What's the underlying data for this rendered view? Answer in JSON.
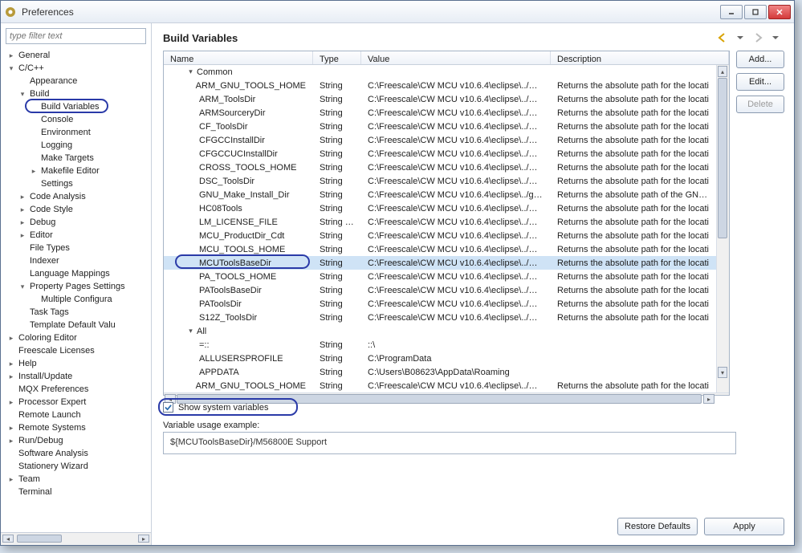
{
  "window": {
    "title": "Preferences"
  },
  "filter": {
    "placeholder": "type filter text"
  },
  "page": {
    "title": "Build Variables"
  },
  "tree": [
    {
      "label": "General",
      "expand": "closed"
    },
    {
      "label": "C/C++",
      "expand": "open",
      "children": [
        {
          "label": "Appearance"
        },
        {
          "label": "Build",
          "expand": "open",
          "children": [
            {
              "label": "Build Variables",
              "highlighted": true
            },
            {
              "label": "Console"
            },
            {
              "label": "Environment"
            },
            {
              "label": "Logging"
            },
            {
              "label": "Make Targets"
            },
            {
              "label": "Makefile Editor",
              "expand": "closed"
            },
            {
              "label": "Settings"
            }
          ]
        },
        {
          "label": "Code Analysis",
          "expand": "closed"
        },
        {
          "label": "Code Style",
          "expand": "closed"
        },
        {
          "label": "Debug",
          "expand": "closed"
        },
        {
          "label": "Editor",
          "expand": "closed"
        },
        {
          "label": "File Types"
        },
        {
          "label": "Indexer"
        },
        {
          "label": "Language Mappings"
        },
        {
          "label": "Property Pages Settings",
          "expand": "open",
          "children": [
            {
              "label": "Multiple Configura"
            }
          ]
        },
        {
          "label": "Task Tags"
        },
        {
          "label": "Template Default Valu"
        }
      ]
    },
    {
      "label": "Coloring Editor",
      "expand": "closed"
    },
    {
      "label": "Freescale Licenses"
    },
    {
      "label": "Help",
      "expand": "closed"
    },
    {
      "label": "Install/Update",
      "expand": "closed"
    },
    {
      "label": "MQX Preferences"
    },
    {
      "label": "Processor Expert",
      "expand": "closed"
    },
    {
      "label": "Remote Launch"
    },
    {
      "label": "Remote Systems",
      "expand": "closed"
    },
    {
      "label": "Run/Debug",
      "expand": "closed"
    },
    {
      "label": "Software Analysis"
    },
    {
      "label": "Stationery Wizard"
    },
    {
      "label": "Team",
      "expand": "closed"
    },
    {
      "label": "Terminal"
    }
  ],
  "columns": {
    "name": "Name",
    "type": "Type",
    "value": "Value",
    "desc": "Description"
  },
  "groups": {
    "common": "Common",
    "all": "All"
  },
  "rows_common": [
    {
      "name": "ARM_GNU_TOOLS_HOME",
      "type": "String",
      "value": "C:\\Freescale\\CW MCU v10.6.4\\eclipse\\../Cro...",
      "desc": "Returns the absolute path for the locati"
    },
    {
      "name": "ARM_ToolsDir",
      "type": "String",
      "value": "C:\\Freescale\\CW MCU v10.6.4\\eclipse\\../MC...",
      "desc": "Returns the absolute path for the locati"
    },
    {
      "name": "ARMSourceryDir",
      "type": "String",
      "value": "C:\\Freescale\\CW MCU v10.6.4\\eclipse\\../MC...",
      "desc": "Returns the absolute path for the locati"
    },
    {
      "name": "CF_ToolsDir",
      "type": "String",
      "value": "C:\\Freescale\\CW MCU v10.6.4\\eclipse\\../MC...",
      "desc": "Returns the absolute path for the locati"
    },
    {
      "name": "CFGCCInstallDir",
      "type": "String",
      "value": "C:\\Freescale\\CW MCU v10.6.4\\eclipse\\../Cro...",
      "desc": "Returns the absolute path for the locati"
    },
    {
      "name": "CFGCCUCInstallDir",
      "type": "String",
      "value": "C:\\Freescale\\CW MCU v10.6.4\\eclipse\\../Cro...",
      "desc": "Returns the absolute path for the locati"
    },
    {
      "name": "CROSS_TOOLS_HOME",
      "type": "String",
      "value": "C:\\Freescale\\CW MCU v10.6.4\\eclipse\\../Cro...",
      "desc": "Returns the absolute path for the locati"
    },
    {
      "name": "DSC_ToolsDir",
      "type": "String",
      "value": "C:\\Freescale\\CW MCU v10.6.4\\eclipse\\../MC...",
      "desc": "Returns the absolute path for the locati"
    },
    {
      "name": "GNU_Make_Install_Dir",
      "type": "String",
      "value": "C:\\Freescale\\CW MCU v10.6.4\\eclipse\\../gn...",
      "desc": "Returns the absolute path of the GNU m"
    },
    {
      "name": "HC08Tools",
      "type": "String",
      "value": "C:\\Freescale\\CW MCU v10.6.4\\eclipse\\../MC...",
      "desc": "Returns the absolute path for the locati"
    },
    {
      "name": "LM_LICENSE_FILE",
      "type": "String List",
      "value": "C:\\Freescale\\CW MCU v10.6.4\\eclipse\\../MC...",
      "desc": "Returns the absolute path for the locati"
    },
    {
      "name": "MCU_ProductDir_Cdt",
      "type": "String",
      "value": "C:\\Freescale\\CW MCU v10.6.4\\eclipse\\../MC...",
      "desc": "Returns the absolute path for the locati"
    },
    {
      "name": "MCU_TOOLS_HOME",
      "type": "String",
      "value": "C:\\Freescale\\CW MCU v10.6.4\\eclipse\\../MCU",
      "desc": "Returns the absolute path for the locati"
    },
    {
      "name": "MCUToolsBaseDir",
      "type": "String",
      "value": "C:\\Freescale\\CW MCU v10.6.4\\eclipse\\../MCU",
      "desc": "Returns the absolute path for the locati",
      "selected": true,
      "highlighted": true
    },
    {
      "name": "PA_TOOLS_HOME",
      "type": "String",
      "value": "C:\\Freescale\\CW MCU v10.6.4\\eclipse\\../MC...",
      "desc": "Returns the absolute path for the locati"
    },
    {
      "name": "PAToolsBaseDir",
      "type": "String",
      "value": "C:\\Freescale\\CW MCU v10.6.4\\eclipse\\../MC...",
      "desc": "Returns the absolute path for the locati"
    },
    {
      "name": "PAToolsDir",
      "type": "String",
      "value": "C:\\Freescale\\CW MCU v10.6.4\\eclipse\\../MC...",
      "desc": "Returns the absolute path for the locati"
    },
    {
      "name": "S12Z_ToolsDir",
      "type": "String",
      "value": "C:\\Freescale\\CW MCU v10.6.4\\eclipse\\../MC...",
      "desc": "Returns the absolute path for the locati"
    }
  ],
  "rows_all": [
    {
      "name": "=::",
      "type": "String",
      "value": "::\\",
      "desc": ""
    },
    {
      "name": "ALLUSERSPROFILE",
      "type": "String",
      "value": "C:\\ProgramData",
      "desc": ""
    },
    {
      "name": "APPDATA",
      "type": "String",
      "value": "C:\\Users\\B08623\\AppData\\Roaming",
      "desc": ""
    },
    {
      "name": "ARM_GNU_TOOLS_HOME",
      "type": "String",
      "value": "C:\\Freescale\\CW MCU v10.6.4\\eclipse\\../Cro...",
      "desc": "Returns the absolute path for the locati"
    }
  ],
  "sideButtons": {
    "add": "Add...",
    "edit": "Edit...",
    "delete": "Delete"
  },
  "checkbox": {
    "label": "Show system variables",
    "checked": true
  },
  "example": {
    "label": "Variable usage example:",
    "value": "${MCUToolsBaseDir}/M56800E Support"
  },
  "footerButtons": {
    "restore": "Restore Defaults",
    "apply": "Apply"
  }
}
